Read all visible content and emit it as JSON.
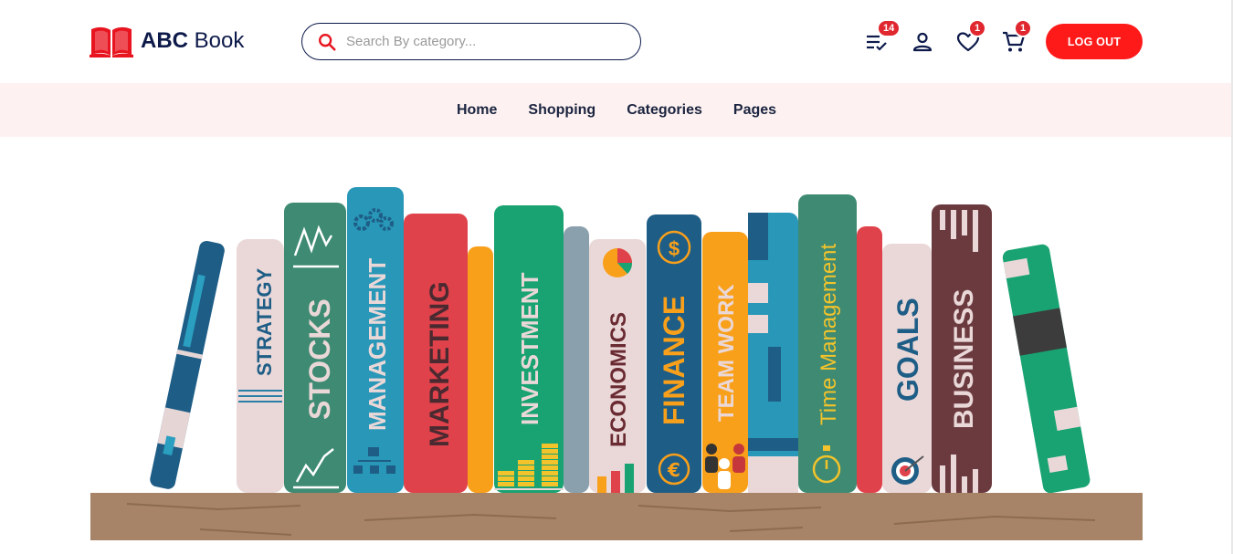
{
  "brand": {
    "bold": "ABC",
    "light": "Book",
    "color": "#e8141f"
  },
  "search": {
    "placeholder": "Search By category..."
  },
  "header_icons": {
    "tasks_badge": "14",
    "wishlist_badge": "1",
    "cart_badge": "1"
  },
  "logout_label": "LOG OUT",
  "nav": {
    "home": "Home",
    "shopping": "Shopping",
    "categories": "Categories",
    "pages": "Pages"
  },
  "books": {
    "strategy": "STRATEGY",
    "stocks": "STOCKS",
    "management": "MANAGEMENT",
    "marketing": "MARKETING",
    "investment": "INVESTMENT",
    "economics": "ECONOMICS",
    "finance": "FINANCE",
    "teamwork": "TEAM WORK",
    "time_management": "Time Management",
    "goals": "GOALS",
    "business": "BUSINESS"
  },
  "colors": {
    "accent": "#ff1a1a",
    "navy": "#0d1a4a",
    "nav_bg": "#fdf2f1",
    "shelf": "#a78467"
  }
}
